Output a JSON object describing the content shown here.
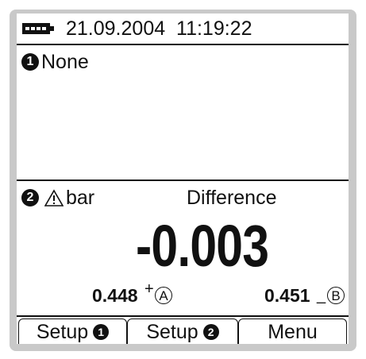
{
  "status": {
    "battery_icon": "battery-icon",
    "date": "21.09.2004",
    "time": "11:19:22"
  },
  "channel1": {
    "number": "1",
    "label": "None"
  },
  "channel2": {
    "number": "2",
    "warning_icon": "warning-triangle-icon",
    "unit": "bar",
    "mode": "Difference",
    "reading": "-0.003",
    "input_a_value": "0.448",
    "input_a_sign": "+",
    "input_a_port": "A",
    "input_b_value": "0.451",
    "input_b_sign": "_",
    "input_b_port": "B"
  },
  "softkeys": {
    "setup1_label": "Setup",
    "setup1_num": "1",
    "setup2_label": "Setup",
    "setup2_num": "2",
    "menu_label": "Menu"
  }
}
